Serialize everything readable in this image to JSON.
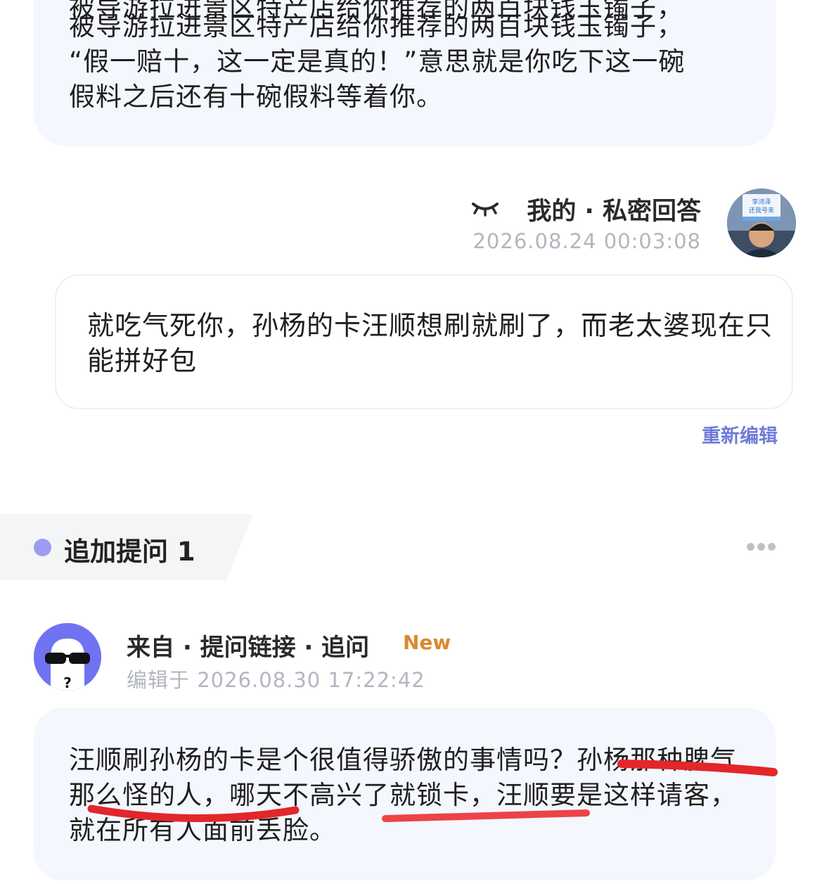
{
  "previous_answer": {
    "lines": [
      "被导游拉进景区特产店给你推荐的两百块钱玉镯子，",
      "“假一赔十，这一定是真的！”意思就是你吃下这一碗",
      "假料之后还有十碗假料等着你。"
    ]
  },
  "private_answer": {
    "title": "我的 · 私密回答",
    "timestamp": "2026.08.24 00:03:08",
    "avatar_sign_text": "李沛泽 还我号来",
    "text": "就吃气死你，孙杨的卡汪顺想刷就刷了，而老太婆现在只能拼好包",
    "reedit_label": "重新编辑",
    "icons": {
      "visibility": "closed-eye-icon"
    }
  },
  "followup": {
    "tag_label": "追加提问 1",
    "more_icon": "more-horizontal-icon",
    "source": "来自 · 提问链接 · 追问",
    "new_badge": "New",
    "edited_time": "编辑于 2026.08.30 17:22:42",
    "question_text": "汪顺刷孙杨的卡是个很值得骄傲的事情吗？孙杨那种脾气那么怪的人，哪天不高兴了就锁卡，汪顺要是这样请客，就在所有人面前丢脸。"
  },
  "colors": {
    "bubble_bg": "#f4f7fd",
    "accent_purple": "#6f7bd9",
    "tag_dot": "#9b9cf0",
    "new_badge": "#d88a2f",
    "timestamp": "#b3b6bf",
    "annotation_red": "#e3262a"
  }
}
